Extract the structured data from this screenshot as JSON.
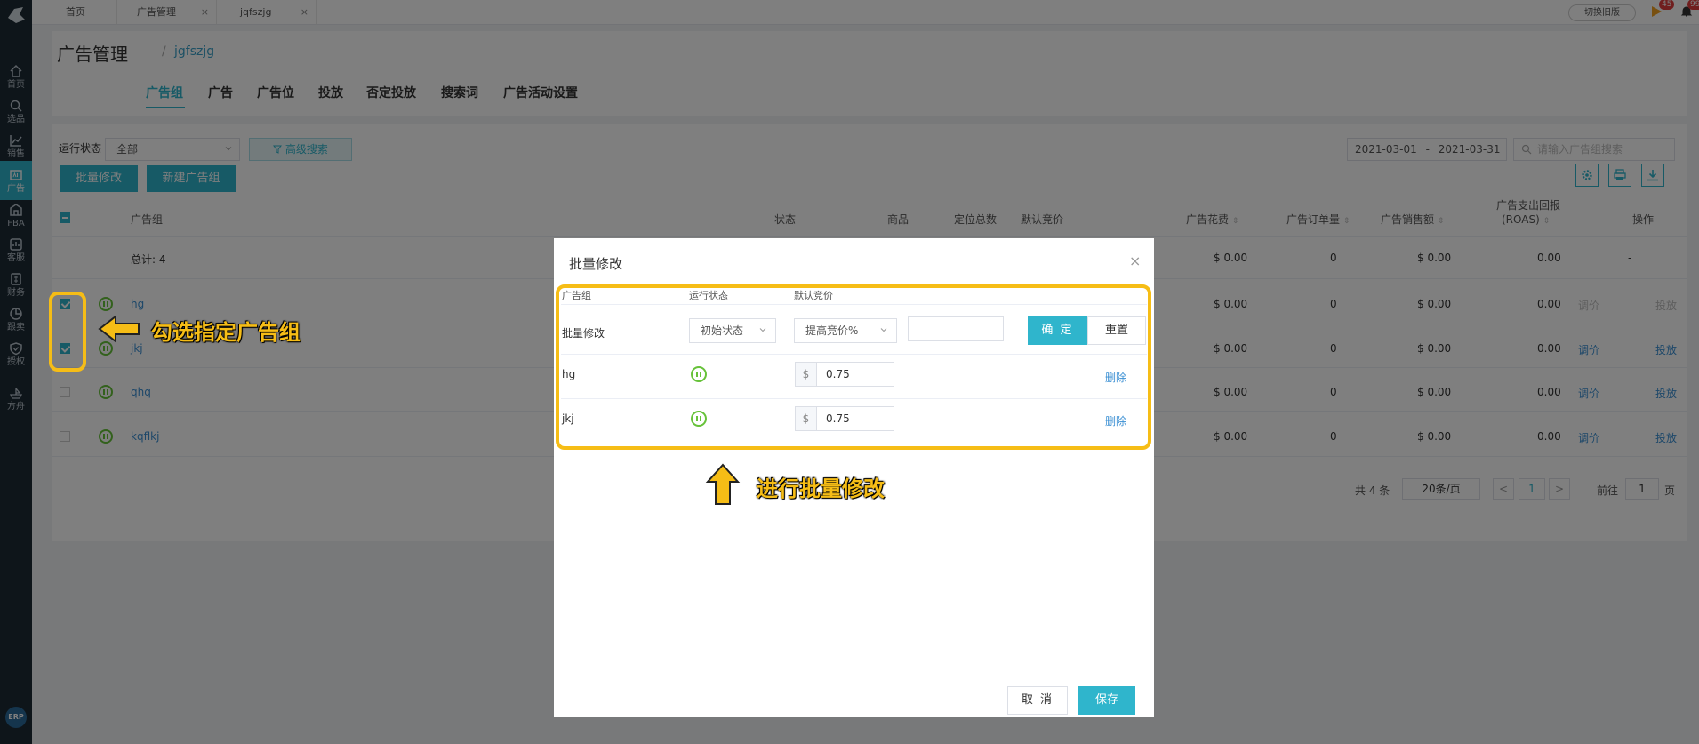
{
  "sidebar": {
    "items": [
      {
        "icon": "home-icon",
        "label": "首页"
      },
      {
        "icon": "search-icon",
        "label": "选品"
      },
      {
        "icon": "chart-line-icon",
        "label": "销售"
      },
      {
        "icon": "ad-icon",
        "label": "广告"
      },
      {
        "icon": "fba-icon",
        "label": "FBA"
      },
      {
        "icon": "customer-service-icon",
        "label": "客服"
      },
      {
        "icon": "finance-icon",
        "label": "财务"
      },
      {
        "icon": "pie-chart-icon",
        "label": "跟卖"
      },
      {
        "icon": "shield-icon",
        "label": "授权"
      },
      {
        "icon": "ark-icon",
        "label": "方舟"
      }
    ],
    "erp": "ERP"
  },
  "topbar": {
    "tabs": [
      "首页",
      "广告管理",
      "jqfszjg"
    ],
    "old_version": "切换旧版",
    "flag_badge": "45",
    "bell_badge": "99+"
  },
  "header": {
    "title": "广告管理",
    "separator": "/",
    "crumb": "jgfszjg",
    "tabs": [
      "广告组",
      "广告",
      "广告位",
      "投放",
      "否定投放",
      "搜索词",
      "广告活动设置"
    ]
  },
  "filters": {
    "status_label": "运行状态",
    "status_value": "全部",
    "advanced": "高级搜索",
    "date_start": "2021-03-01",
    "date_sep": "-",
    "date_end": "2021-03-31",
    "search_placeholder": "请输入广告组搜索"
  },
  "actions": {
    "batch_edit": "批量修改",
    "new_group": "新建广告组"
  },
  "table": {
    "headers": {
      "group": "广告组",
      "status": "状态",
      "product": "商品",
      "targets": "定位总数",
      "default_bid": "默认竞价",
      "spend": "广告花费",
      "orders": "广告订单量",
      "sales": "广告销售额",
      "roas_1": "广告支出回报",
      "roas_2": "(ROAS)",
      "ops": "操作"
    },
    "total": {
      "label": "总计: 4",
      "spend": "$ 0.00",
      "orders": "0",
      "sales": "$ 0.00",
      "roas": "0.00",
      "ops": "-"
    },
    "rows": [
      {
        "name": "hg",
        "checked": true,
        "spend": "$ 0.00",
        "orders": "0",
        "sales": "$ 0.00",
        "roas": "0.00",
        "adjust": "调价",
        "target": "投放"
      },
      {
        "name": "jkj",
        "checked": true,
        "spend": "$ 0.00",
        "orders": "0",
        "sales": "$ 0.00",
        "roas": "0.00",
        "adjust": "调价",
        "target": "投放"
      },
      {
        "name": "qhq",
        "checked": false,
        "spend": "$ 0.00",
        "orders": "0",
        "sales": "$ 0.00",
        "roas": "0.00",
        "adjust": "调价",
        "target": "投放"
      },
      {
        "name": "kqflkj",
        "checked": false,
        "spend": "$ 0.00",
        "orders": "0",
        "sales": "$ 0.00",
        "roas": "0.00",
        "adjust": "调价",
        "target": "投放"
      }
    ]
  },
  "pagination": {
    "total": "共 4 条",
    "page_size": "20条/页",
    "prev": "<",
    "page": "1",
    "next": ">",
    "goto": "前往",
    "goto_value": "1",
    "page_unit": "页"
  },
  "modal": {
    "title": "批量修改",
    "close": "×",
    "headers": {
      "group": "广告组",
      "status": "运行状态",
      "bid": "默认竞价"
    },
    "batch": {
      "label": "批量修改",
      "status": "初始状态",
      "mode": "提高竞价%",
      "value": "",
      "ok": "确 定",
      "reset": "重置"
    },
    "rows": [
      {
        "name": "hg",
        "currency": "$",
        "bid": "0.75",
        "delete": "删除"
      },
      {
        "name": "jkj",
        "currency": "$",
        "bid": "0.75",
        "delete": "删除"
      }
    ],
    "cancel": "取 消",
    "save": "保存"
  },
  "annotations": {
    "select_groups": "勾选指定广告组",
    "batch_edit": "进行批量修改",
    "color": "#f6bd16"
  },
  "colors": {
    "accent": "#2fb5cc",
    "sidebar": "#1c2a35",
    "link": "#3a8fd3",
    "active_status": "#67c23a"
  }
}
